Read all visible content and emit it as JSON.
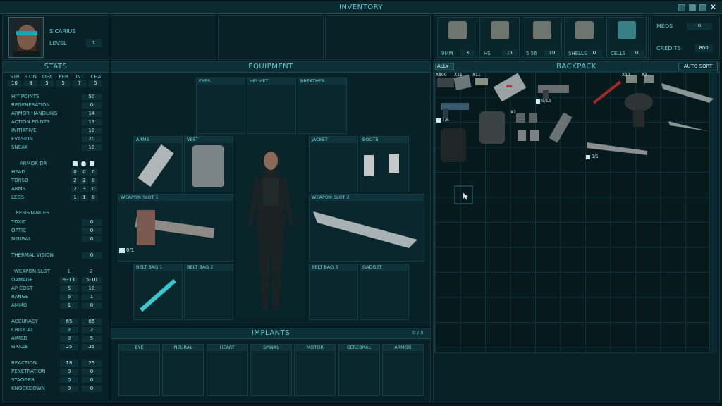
{
  "window": {
    "title": "INVENTORY",
    "close_glyph": "X"
  },
  "character": {
    "name": "SICARIUS",
    "level_label": "LEVEL",
    "level": "1"
  },
  "ammo": [
    {
      "label": "9MM",
      "count": "3"
    },
    {
      "label": "HS",
      "count": "11"
    },
    {
      "label": "5.56",
      "count": "10"
    },
    {
      "label": "SHELLS",
      "count": "0"
    },
    {
      "label": "CELLS",
      "count": "0"
    }
  ],
  "meds": {
    "label": "MEDS",
    "value": "0"
  },
  "credits": {
    "label": "CREDITS",
    "value": "800"
  },
  "stats": {
    "title": "STATS",
    "attributes": [
      {
        "abbr": "STR",
        "value": "10"
      },
      {
        "abbr": "CON",
        "value": "8"
      },
      {
        "abbr": "DEX",
        "value": "5"
      },
      {
        "abbr": "PER",
        "value": "5"
      },
      {
        "abbr": "INT",
        "value": "7"
      },
      {
        "abbr": "CHA",
        "value": "5"
      }
    ],
    "core": [
      {
        "label": "HIT POINTS",
        "value": "50"
      },
      {
        "label": "REGENERATION",
        "value": "0"
      },
      {
        "label": "ARMOR HANDLING",
        "value": "14"
      },
      {
        "label": "ACTION POINTS",
        "value": "13"
      },
      {
        "label": "INITIATIVE",
        "value": "10"
      },
      {
        "label": "EVASION",
        "value": "20"
      },
      {
        "label": "SNEAK",
        "value": "10"
      }
    ],
    "armor_dr_label": "ARMOR DR",
    "armor_dr": [
      {
        "label": "HEAD",
        "values": [
          "0",
          "0",
          "0"
        ]
      },
      {
        "label": "TORSO",
        "values": [
          "2",
          "2",
          "0"
        ]
      },
      {
        "label": "ARMS",
        "values": [
          "2",
          "3",
          "0"
        ]
      },
      {
        "label": "LEGS",
        "values": [
          "1",
          "1",
          "0"
        ]
      }
    ],
    "resistances_label": "RESISTANCES",
    "resistances": [
      {
        "label": "TOXIC",
        "value": "0"
      },
      {
        "label": "OPTIC",
        "value": "0"
      },
      {
        "label": "NEURAL",
        "value": "0"
      }
    ],
    "thermal": {
      "label": "THERMAL VISION",
      "value": "0"
    },
    "weapon_slot_label": "WEAPON SLOT",
    "weapon_slot_cols": [
      "1",
      "2"
    ],
    "weapon": [
      {
        "label": "DAMAGE",
        "values": [
          "9-13",
          "5-10"
        ]
      },
      {
        "label": "AP COST",
        "values": [
          "5",
          "10"
        ]
      },
      {
        "label": "RANGE",
        "values": [
          "6",
          "1"
        ]
      },
      {
        "label": "AMMO",
        "values": [
          "1",
          "0"
        ]
      }
    ],
    "combat": [
      {
        "label": "ACCURACY",
        "values": [
          "65",
          "65"
        ]
      },
      {
        "label": "CRITICAL",
        "values": [
          "2",
          "2"
        ]
      },
      {
        "label": "AIMED",
        "values": [
          "0",
          "5"
        ]
      },
      {
        "label": "GRAZE",
        "values": [
          "25",
          "25"
        ]
      }
    ],
    "misc": [
      {
        "label": "REACTION",
        "values": [
          "18",
          "25"
        ]
      },
      {
        "label": "PENETRATION",
        "values": [
          "0",
          "0"
        ]
      },
      {
        "label": "STAGGER",
        "values": [
          "0",
          "0"
        ]
      },
      {
        "label": "KNOCKDOWN",
        "values": [
          "0",
          "0"
        ]
      }
    ]
  },
  "equipment": {
    "title": "EQUIPMENT",
    "slots": {
      "eyes": "EYES",
      "helmet": "HELMET",
      "breather": "BREATHER",
      "arms": "ARMS",
      "vest": "VEST",
      "jacket": "JACKET",
      "boots": "BOOTS",
      "weapon1": "WEAPON SLOT 1",
      "weapon2": "WEAPON SLOT 2",
      "belt1": "BELT BAG 1",
      "belt2": "BELT BAG 2",
      "belt3": "BELT BAG 3",
      "gadget": "GADGET"
    },
    "weapon1_ammo": "0/1"
  },
  "implants": {
    "title": "IMPLANTS",
    "count": "0 / 5",
    "slots": [
      "EYE",
      "NEURAL",
      "HEART",
      "SPINAL",
      "MOTOR",
      "CEREBRAL",
      "ARMOR"
    ]
  },
  "backpack": {
    "title": "BACKPACK",
    "filter": "ALL",
    "auto_sort": "AUTO SORT",
    "badges": {
      "x800": "X800",
      "x11a": "X11",
      "x11b": "X11",
      "x10": "X10",
      "x3": "X3",
      "x2": "X2"
    },
    "ammo_counts": {
      "pistol": "0/12",
      "revolver": "1/6",
      "shotgun": "3/5"
    }
  }
}
